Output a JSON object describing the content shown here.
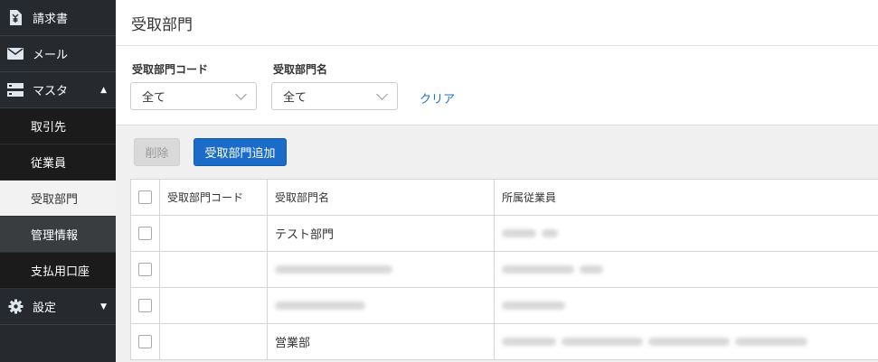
{
  "sidebar": {
    "invoice_label": "請求書",
    "mail_label": "メール",
    "master_label": "マスタ",
    "sub_items": [
      {
        "label": "取引先"
      },
      {
        "label": "従業員"
      },
      {
        "label": "受取部門"
      },
      {
        "label": "管理情報"
      },
      {
        "label": "支払用口座"
      }
    ],
    "settings_label": "設定"
  },
  "page": {
    "title": "受取部門"
  },
  "filters": {
    "code_label": "受取部門コード",
    "code_value": "全て",
    "name_label": "受取部門名",
    "name_value": "全て",
    "clear_label": "クリア"
  },
  "toolbar": {
    "delete_label": "削除",
    "add_label": "受取部門追加"
  },
  "table": {
    "headers": [
      "受取部門コード",
      "受取部門名",
      "所属従業員"
    ],
    "rows": [
      {
        "code": "",
        "name": "テスト部門"
      },
      {
        "code": "",
        "name": ""
      },
      {
        "code": "",
        "name": ""
      },
      {
        "code": "",
        "name": "営業部"
      }
    ]
  },
  "colors": {
    "sidebar_bg": "#262a2e",
    "accent": "#1a6cc8",
    "link": "#1a73c9"
  },
  "icons": [
    "yen-document-icon",
    "mail-icon",
    "server-icon",
    "gear-icon"
  ]
}
